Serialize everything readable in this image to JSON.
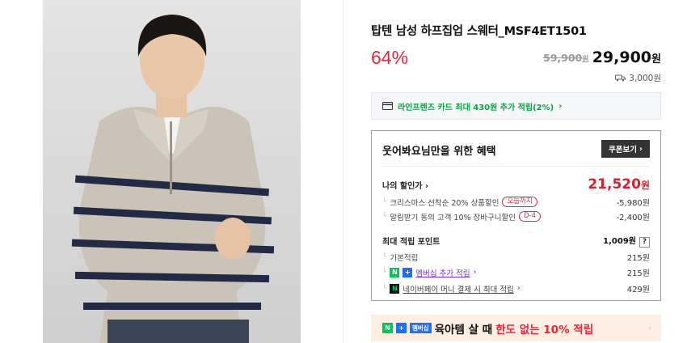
{
  "product": {
    "title": "탑텐 남성 하프집업 스웨터_MSF4ET1501",
    "discount": "64%",
    "original_price": "59,900",
    "original_price_unit": "원",
    "price": "29,900",
    "price_unit": "원",
    "shipping": "3,000원"
  },
  "card_banner": {
    "text": "라인프렌즈 카드 최대 430원 추가 적립(2%)",
    "arrow": "›"
  },
  "benefit": {
    "heading": "웃어봐요님만을 위한 혜택",
    "coupon_button": "쿠폰보기",
    "my_discount_label": "나의 할인가",
    "my_discount_price": "21,520",
    "my_discount_unit": "원",
    "sub1_label": "크리스마스 선착순 20% 상품할인",
    "sub1_tag": "오늘까지",
    "sub1_value": "-5,980원",
    "sub2_label": "알림받기 동의 고객 10% 장바구니할인",
    "sub2_tag": "D-4",
    "sub2_value": "-2,400원",
    "points_label": "최대 적립 포인트",
    "points_value": "1,009원",
    "points_help": "?",
    "basic_label": "기본적립",
    "basic_value": "215원",
    "membership_label": "멤버십 추가 적립",
    "membership_value": "215원",
    "naverpay_label": "네이버페이 머니 결제 시 최대 적립",
    "naverpay_value": "429원"
  },
  "promo": {
    "chip": "멤버십",
    "main": "육아템 살 때",
    "highlight": "한도 없는 10% 적립"
  },
  "colors": {
    "red": "#e0293c",
    "green": "#03c75a",
    "purple": "#7a2fd1",
    "promo_bg": "#fdeee2"
  }
}
